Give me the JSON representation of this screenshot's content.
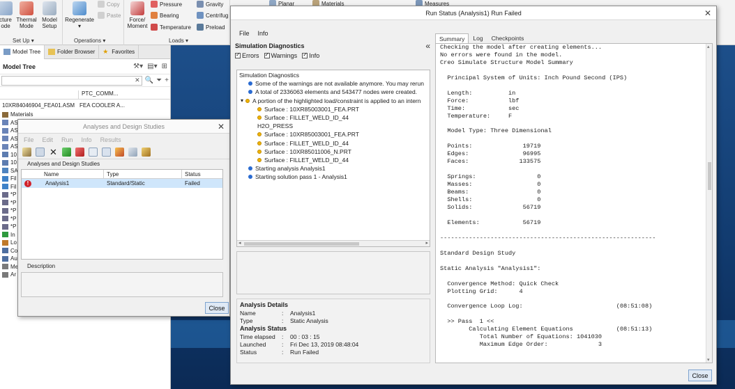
{
  "ribbon": {
    "structure_label_a": "cture",
    "structure_label_b": "ode",
    "thermal_mode_a": "Thermal",
    "thermal_mode_b": "Mode",
    "model_setup_a": "Model",
    "model_setup_b": "Setup",
    "regenerate": "Regenerate",
    "copy": "Copy",
    "paste": "Paste",
    "setup_group": "Set Up",
    "operations_group": "Operations",
    "force_moment_a": "Force/",
    "force_moment_b": "Moment",
    "pressure": "Pressure",
    "bearing": "Bearing",
    "temperature": "Temperature",
    "gravity": "Gravity",
    "centrifugal": "Centrifug",
    "preload": "Preload",
    "loads_group": "Loads",
    "planar": "Planar",
    "materials": "Materials",
    "measures": "Measures"
  },
  "left_panel": {
    "tabs": [
      "Model Tree",
      "Folder Browser",
      "Favorites"
    ],
    "header": "Model Tree",
    "col_param": "PTC_COMM...",
    "root_name": "10XR84046904_FEA01.ASM",
    "root_param": "FEA COOLER A...",
    "items": [
      "Materials",
      "AS",
      "AS",
      "AS",
      "AS",
      "10",
      "10",
      "SA",
      "Fil",
      "Fil",
      "*P",
      "*P",
      "*P",
      "*P",
      "*P",
      "In",
      "Lo",
      "Co",
      "Au",
      "Me",
      "Ar"
    ]
  },
  "analyses_dialog": {
    "title": "Analyses and Design Studies",
    "menu": [
      "File",
      "Edit",
      "Run",
      "Info",
      "Results"
    ],
    "group_label": "Analyses and Design Studies",
    "columns": [
      "Name",
      "Type",
      "Status"
    ],
    "rows": [
      {
        "name": "Analysis1",
        "type": "Standard/Static",
        "status": "Failed"
      }
    ],
    "description_label": "Description",
    "close_label": "Close"
  },
  "run_status": {
    "title": "Run Status (Analysis1) Run Failed",
    "menu": [
      "File",
      "Info"
    ],
    "diag_header": "Simulation Diagnostics",
    "collapse_glyph": "«",
    "filters": [
      "Errors",
      "Warnings",
      "Info"
    ],
    "diag_rows": [
      {
        "indent": 0,
        "dot": "",
        "text": "Simulation Diagnostics"
      },
      {
        "indent": 1,
        "dot": "blue",
        "text": "Some of the warnings are not available anymore. You may rerun"
      },
      {
        "indent": 1,
        "dot": "blue",
        "text": "A total of 2336063 elements and 543477 nodes were created."
      },
      {
        "indent": 1,
        "dot": "yellow",
        "expand": "▾",
        "text": "A portion of the highlighted load/constraint is applied to an intern"
      },
      {
        "indent": 2,
        "dot": "yellow",
        "text": "Surface : 10XR85003001_FEA.PRT"
      },
      {
        "indent": 2,
        "dot": "yellow",
        "text": "Surface : FILLET_WELD_ID_44"
      },
      {
        "indent": 2,
        "dot": "",
        "text": "H2O_PRESS"
      },
      {
        "indent": 2,
        "dot": "yellow",
        "text": "Surface : 10XR85003001_FEA.PRT"
      },
      {
        "indent": 2,
        "dot": "yellow",
        "text": "Surface : FILLET_WELD_ID_44"
      },
      {
        "indent": 2,
        "dot": "yellow",
        "text": "Surface : 10XR85011006_N.PRT"
      },
      {
        "indent": 2,
        "dot": "yellow",
        "text": "Surface : FILLET_WELD_ID_44"
      },
      {
        "indent": 1,
        "dot": "blue",
        "text": "Starting analysis Analysis1"
      },
      {
        "indent": 1,
        "dot": "blue",
        "text": "Starting solution pass 1 - Analysis1"
      }
    ],
    "details_header": "Analysis Details",
    "details": [
      {
        "k": "Name",
        "v": "Analysis1"
      },
      {
        "k": "Type",
        "v": "Static Analysis"
      }
    ],
    "status_header": "Analysis Status",
    "status": [
      {
        "k": "Time elapsed",
        "v": "00 : 03 : 15"
      },
      {
        "k": "Launched",
        "v": "Fri Dec 13, 2019   08:48:04"
      },
      {
        "k": "Status",
        "v": "Run Failed"
      }
    ],
    "tabs": [
      "Summary",
      "Log",
      "Checkpoints"
    ],
    "summary_text": "Checking the model after creating elements...\nNo errors were found in the model.\nCreo Simulate Structure Model Summary\n\n  Principal System of Units: Inch Pound Second (IPS)\n\n  Length:          in\n  Force:           lbf\n  Time:            sec\n  Temperature:     F\n\n  Model Type: Three Dimensional\n\n  Points:              19719\n  Edges:               96995\n  Faces:              133575\n\n  Springs:                 0\n  Masses:                  0\n  Beams:                   0\n  Shells:                  0\n  Solids:              56719\n\n  Elements:            56719\n\n------------------------------------------------------------\n\nStandard Design Study\n\nStatic Analysis \"Analysis1\":\n\n  Convergence Method: Quick Check\n  Plotting Grid:      4\n\n  Convergence Loop Log:                          (08:51:08)\n\n  >> Pass  1 <<\n        Calculating Element Equations            (08:51:13)\n           Total Number of Equations: 1041030\n           Maximum Edge Order:              3",
    "close_label": "Close"
  },
  "colors": {
    "error": "#d0202a",
    "info_dot": "#2a6bd1",
    "warn_dot": "#f0b400",
    "selection": "#cfe6fb"
  }
}
